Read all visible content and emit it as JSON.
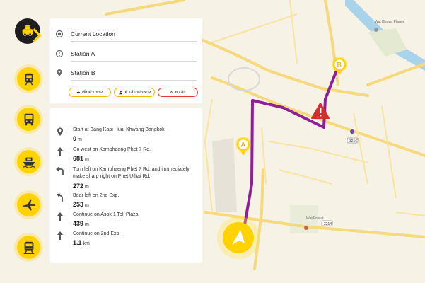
{
  "search": {
    "current_location": "Current Location",
    "station_a": "Station A",
    "station_b": "Station B"
  },
  "actions": {
    "add_stop": "เพิ่มตำแหน่ง",
    "options": "ตัวเลือกเส้นทาง",
    "cancel": "ยกเลิก"
  },
  "steps": [
    {
      "text": "Start at Bang Kapi Huai Khwang Bangkok",
      "value": "0",
      "unit": "m",
      "icon": "pin-icon"
    },
    {
      "text": "Go west on Kamphaeng Phet 7 Rd.",
      "value": "681",
      "unit": "m",
      "icon": "arrow-up-icon"
    },
    {
      "text": "Turn left on Kamphaeng Phet 7 Rd. and i mmediately make sharp right on Phet Uthai Rd.",
      "value": "272",
      "unit": "m",
      "icon": "turn-left-icon"
    },
    {
      "text": "Bear left on 2nd Exp.",
      "value": "253",
      "unit": "m",
      "icon": "bear-left-icon"
    },
    {
      "text": "Continue on Asok 1 Toll Plaza",
      "value": "439",
      "unit": "m",
      "icon": "arrow-up-icon"
    },
    {
      "text": "Continue on 2nd Exp.",
      "value": "1.1",
      "unit": "km",
      "icon": "arrow-up-icon"
    }
  ],
  "modes": [
    "taxi-icon",
    "train-icon",
    "bus-icon",
    "boat-icon",
    "airplane-icon",
    "metro-icon"
  ],
  "map": {
    "marker_a": "A",
    "marker_b": "B",
    "labels": {
      "wat_prasat": "Wat Prasat",
      "wat_khwan": "Wat Khwan Phaen",
      "route_3216": "3216",
      "route_3214": "3214"
    }
  },
  "colors": {
    "route": "#8e1f96",
    "accent": "#ffd200",
    "warning": "#d32f2f",
    "cancel": "#e53935"
  }
}
